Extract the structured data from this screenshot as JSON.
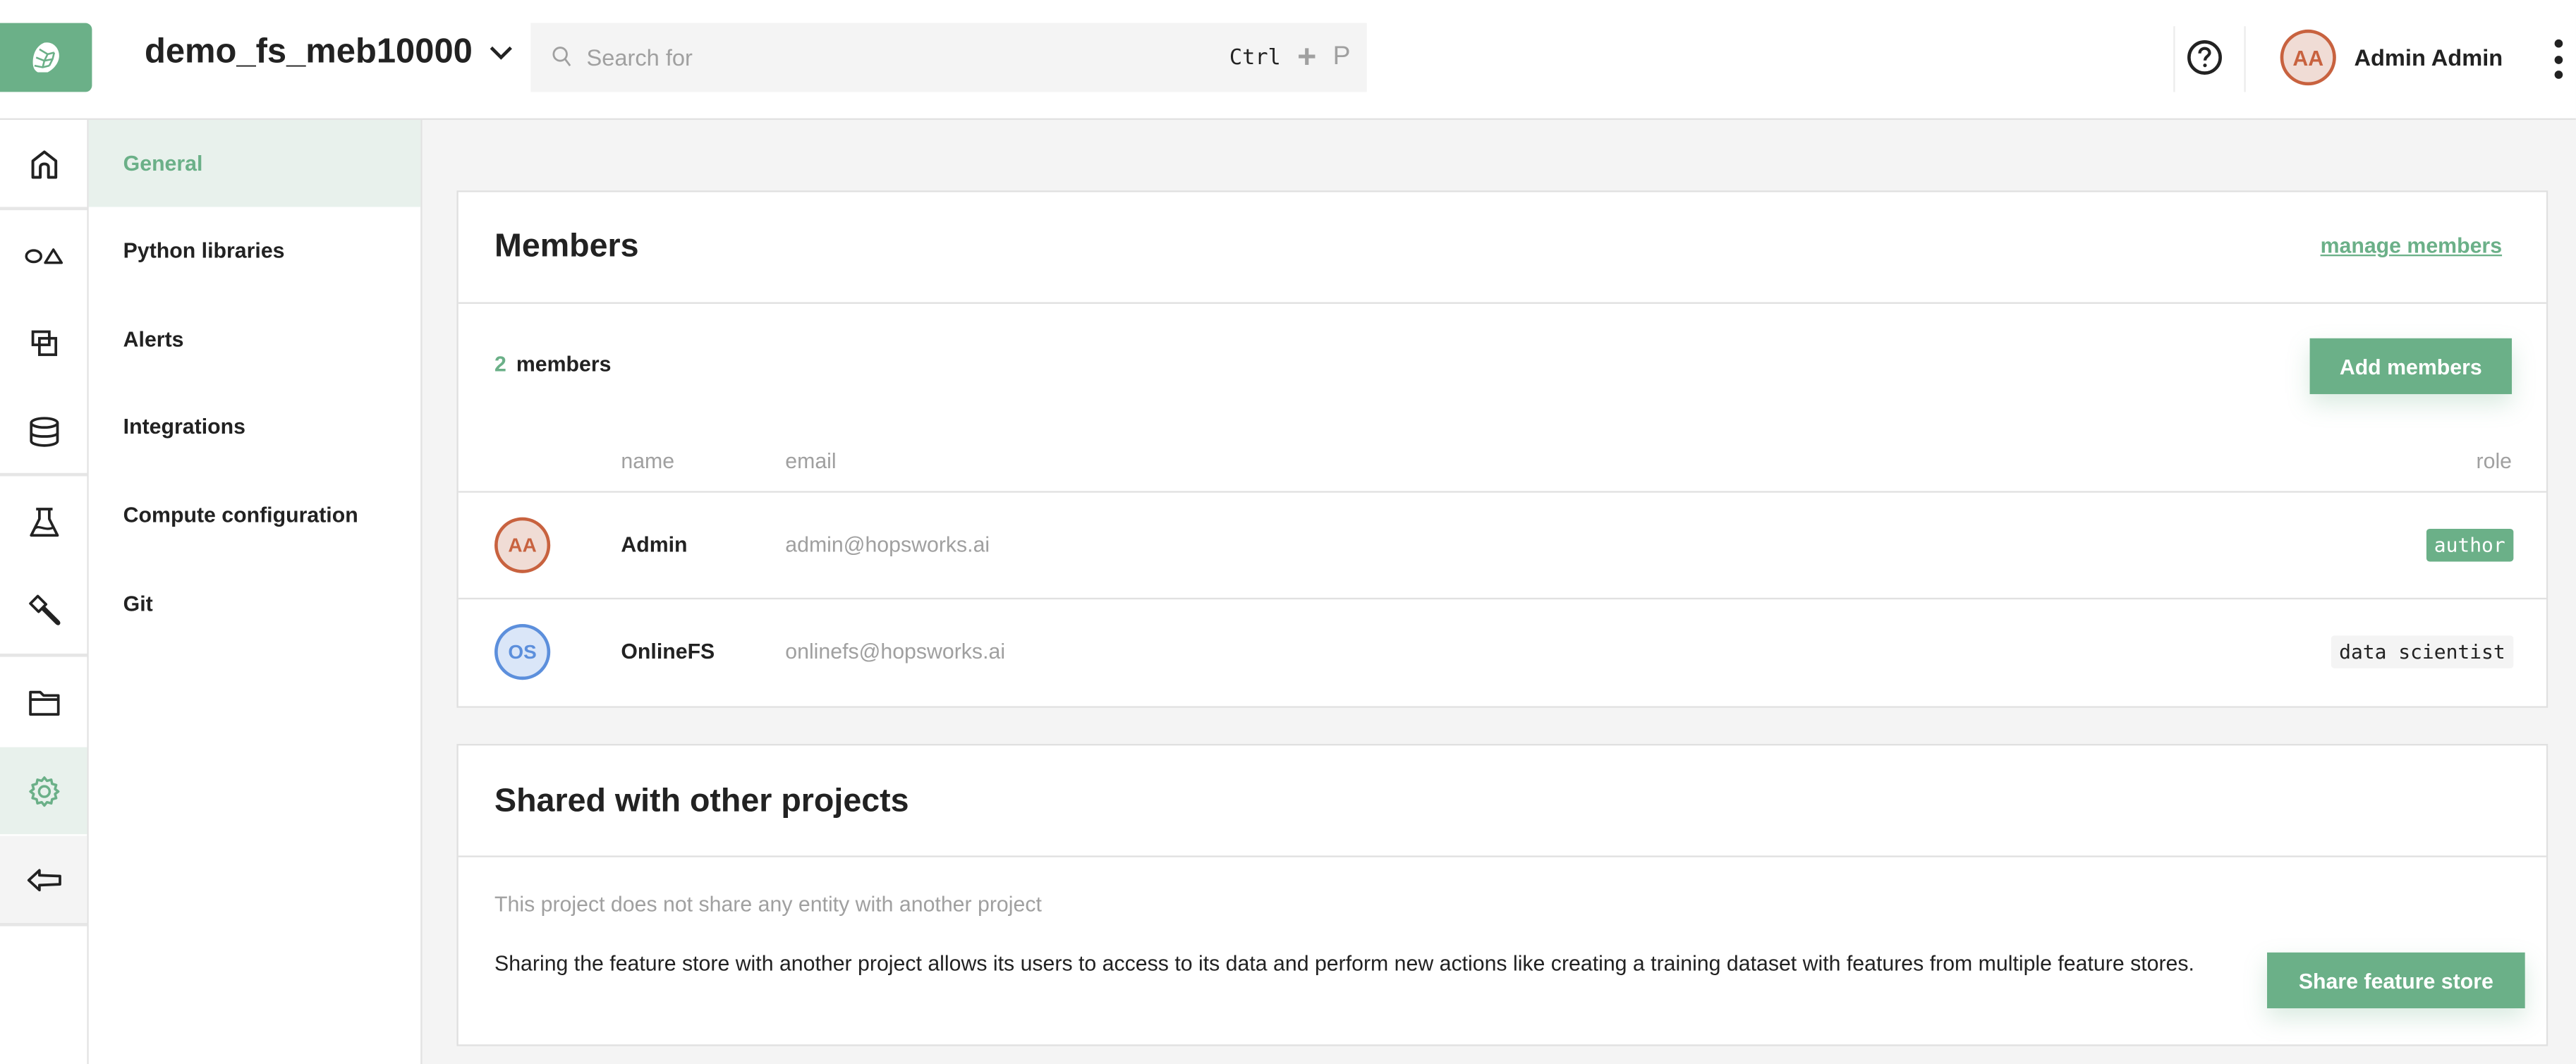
{
  "header": {
    "logo_icon": "hopsworks-logo-icon",
    "project_name": "demo_fs_meb10000",
    "search": {
      "placeholder": "Search for",
      "shortcut_modifier": "Ctrl",
      "shortcut_plus": "+",
      "shortcut_key": "P"
    },
    "user": {
      "initials": "AA",
      "name": "Admin Admin"
    }
  },
  "icon_sidebar": {
    "items": [
      {
        "name": "home",
        "icon": "home-icon"
      },
      {
        "name": "feature-store",
        "icon": "shapes-icon"
      },
      {
        "name": "feature-views",
        "icon": "overlap-squares-icon"
      },
      {
        "name": "data-sources",
        "icon": "database-icon"
      },
      {
        "name": "experiments",
        "icon": "flask-icon"
      },
      {
        "name": "deployments",
        "icon": "hammer-icon"
      },
      {
        "name": "datasets",
        "icon": "folder-icon"
      },
      {
        "name": "settings",
        "icon": "gear-icon",
        "active": true
      },
      {
        "name": "back",
        "icon": "arrow-left-icon"
      }
    ]
  },
  "submenu": {
    "items": [
      {
        "label": "General",
        "active": true
      },
      {
        "label": "Python libraries"
      },
      {
        "label": "Alerts"
      },
      {
        "label": "Integrations"
      },
      {
        "label": "Compute configuration"
      },
      {
        "label": "Git"
      }
    ]
  },
  "members": {
    "title": "Members",
    "manage_link": "manage members",
    "count": "2",
    "count_label": "members",
    "add_button": "Add members",
    "columns": {
      "name": "name",
      "email": "email",
      "role": "role"
    },
    "rows": [
      {
        "initials": "AA",
        "name": "Admin",
        "email": "admin@hopsworks.ai",
        "role": "author",
        "avatar_color": "#c8623f"
      },
      {
        "initials": "OS",
        "name": "OnlineFS",
        "email": "onlinefs@hopsworks.ai",
        "role": "data scientist",
        "avatar_color": "#5c8fdc"
      }
    ]
  },
  "shared": {
    "title": "Shared with other projects",
    "empty_message": "This project does not share any entity with another project",
    "description": "Sharing the feature store with another project allows its users to access to its data and perform new actions like creating a training dataset with features from multiple feature stores.",
    "share_button": "Share feature store"
  },
  "colors": {
    "accent": "#6bb088",
    "accent_light": "#e8f1ec",
    "background": "#f4f4f4",
    "text": "#222222",
    "muted": "#a0a0a0"
  }
}
